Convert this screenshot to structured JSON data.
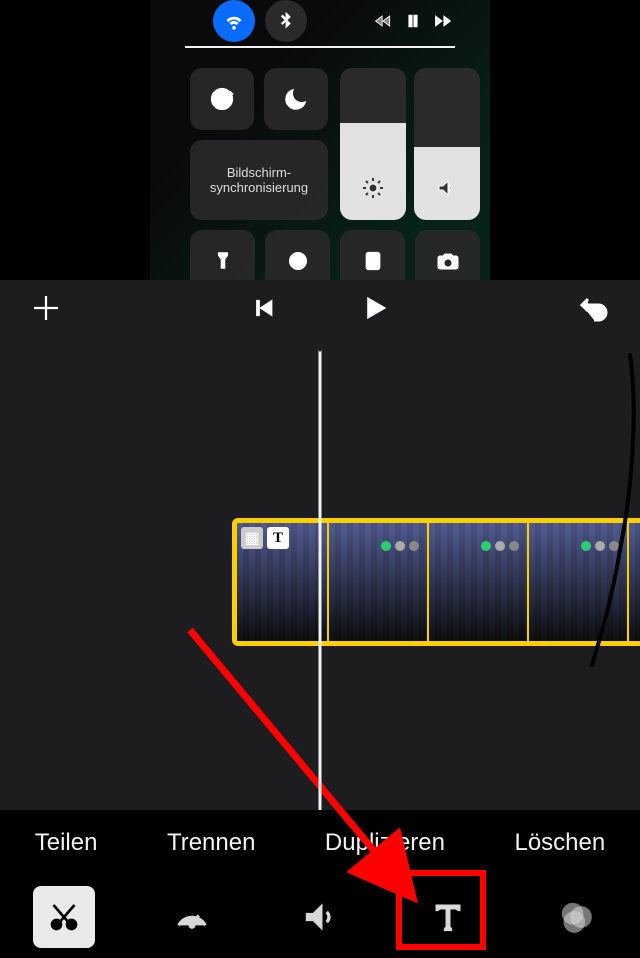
{
  "preview": {
    "screen_mirroring_label": "Bildschirm-\nsynchronisierung"
  },
  "actions": {
    "split": "Teilen",
    "detach": "Trennen",
    "duplicate": "Duplizieren",
    "delete": "Löschen"
  },
  "clip": {
    "title_badge": "T"
  },
  "icons": {
    "add": "add-icon",
    "skip_back": "skip-back-icon",
    "play": "play-icon",
    "undo": "undo-icon",
    "cut": "scissors-icon",
    "speed": "speedometer-icon",
    "volume": "speaker-icon",
    "text": "text-icon",
    "filters": "filters-icon"
  }
}
